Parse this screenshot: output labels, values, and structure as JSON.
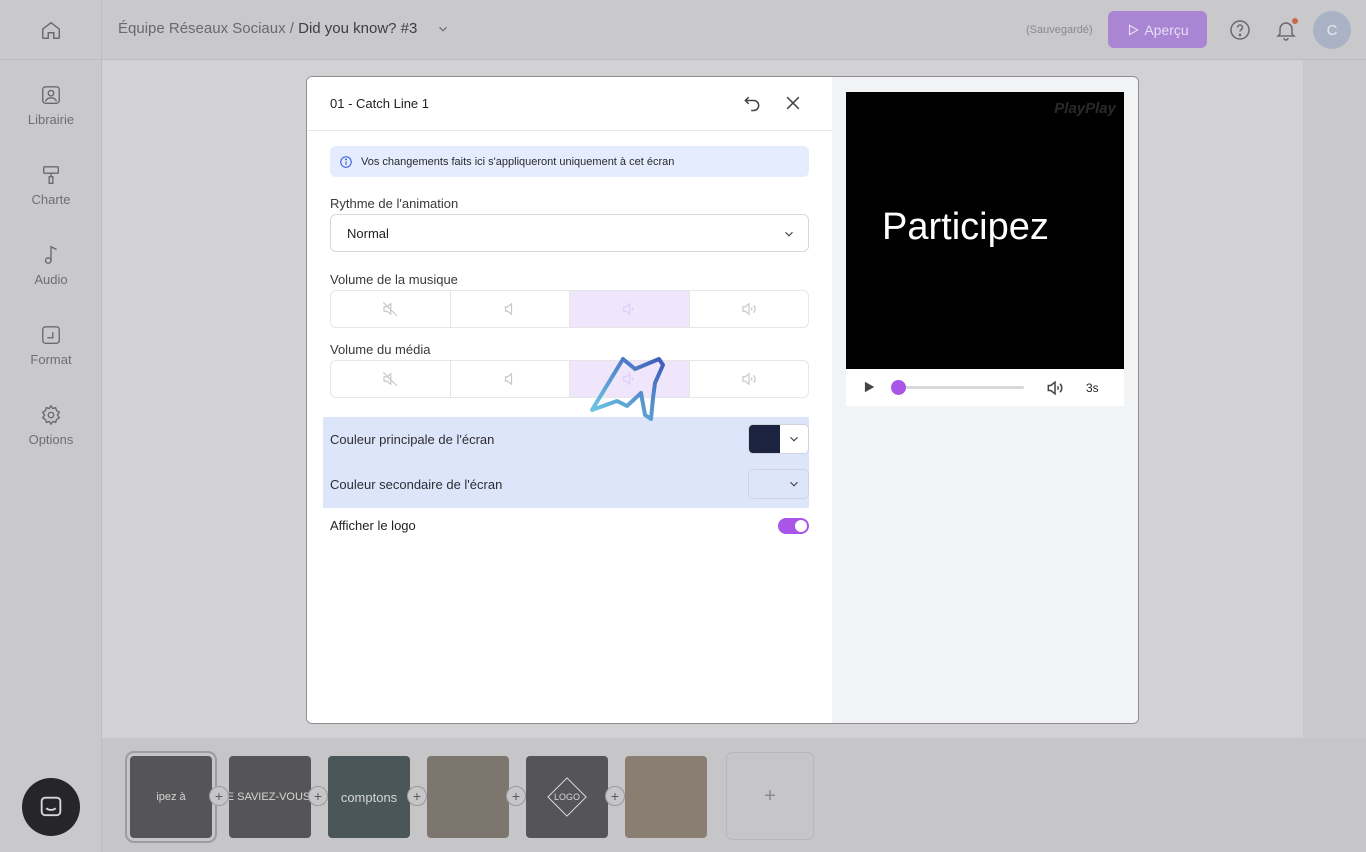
{
  "sidebar": {
    "items": [
      {
        "label": "Librairie",
        "icon": "image-icon"
      },
      {
        "label": "Charte",
        "icon": "paint-roller-icon"
      },
      {
        "label": "Audio",
        "icon": "music-note-icon"
      },
      {
        "label": "Format",
        "icon": "resize-icon"
      },
      {
        "label": "Options",
        "icon": "gear-icon"
      }
    ]
  },
  "header": {
    "team": "Équipe Réseaux Sociaux /",
    "project": "Did you know? #3",
    "saved_status": "(Sauvegardé)",
    "preview_button": "Aperçu",
    "avatar_initial": "C"
  },
  "modal": {
    "title": "01 - Catch Line 1",
    "info_text": "Vos changements faits ici s'appliqueront uniquement à cet écran",
    "rhythm_label": "Rythme de l'animation",
    "rhythm_value": "Normal",
    "music_volume_label": "Volume de la musique",
    "music_volume_level": 2,
    "media_volume_label": "Volume du média",
    "media_volume_level": 2,
    "primary_color_label": "Couleur principale de l'écran",
    "primary_color": "#1b2340",
    "secondary_color_label": "Couleur secondaire de l'écran",
    "secondary_color": "#dde5fb",
    "logo_label": "Afficher le logo",
    "logo_enabled": true
  },
  "preview": {
    "brand": "PlayPlay",
    "headline": "Participez",
    "duration": "3s",
    "progress": 0
  },
  "timeline": {
    "thumbs": [
      {
        "label": "ipez à"
      },
      {
        "label": "LE SAVIEZ-VOUS ?"
      },
      {
        "label": "comptons"
      },
      {
        "label": ""
      },
      {
        "label": "LOGO"
      },
      {
        "label": ""
      }
    ],
    "add_label": "+"
  },
  "colors": {
    "accent": "#a855e8",
    "info_bg": "#e5ecfd"
  }
}
